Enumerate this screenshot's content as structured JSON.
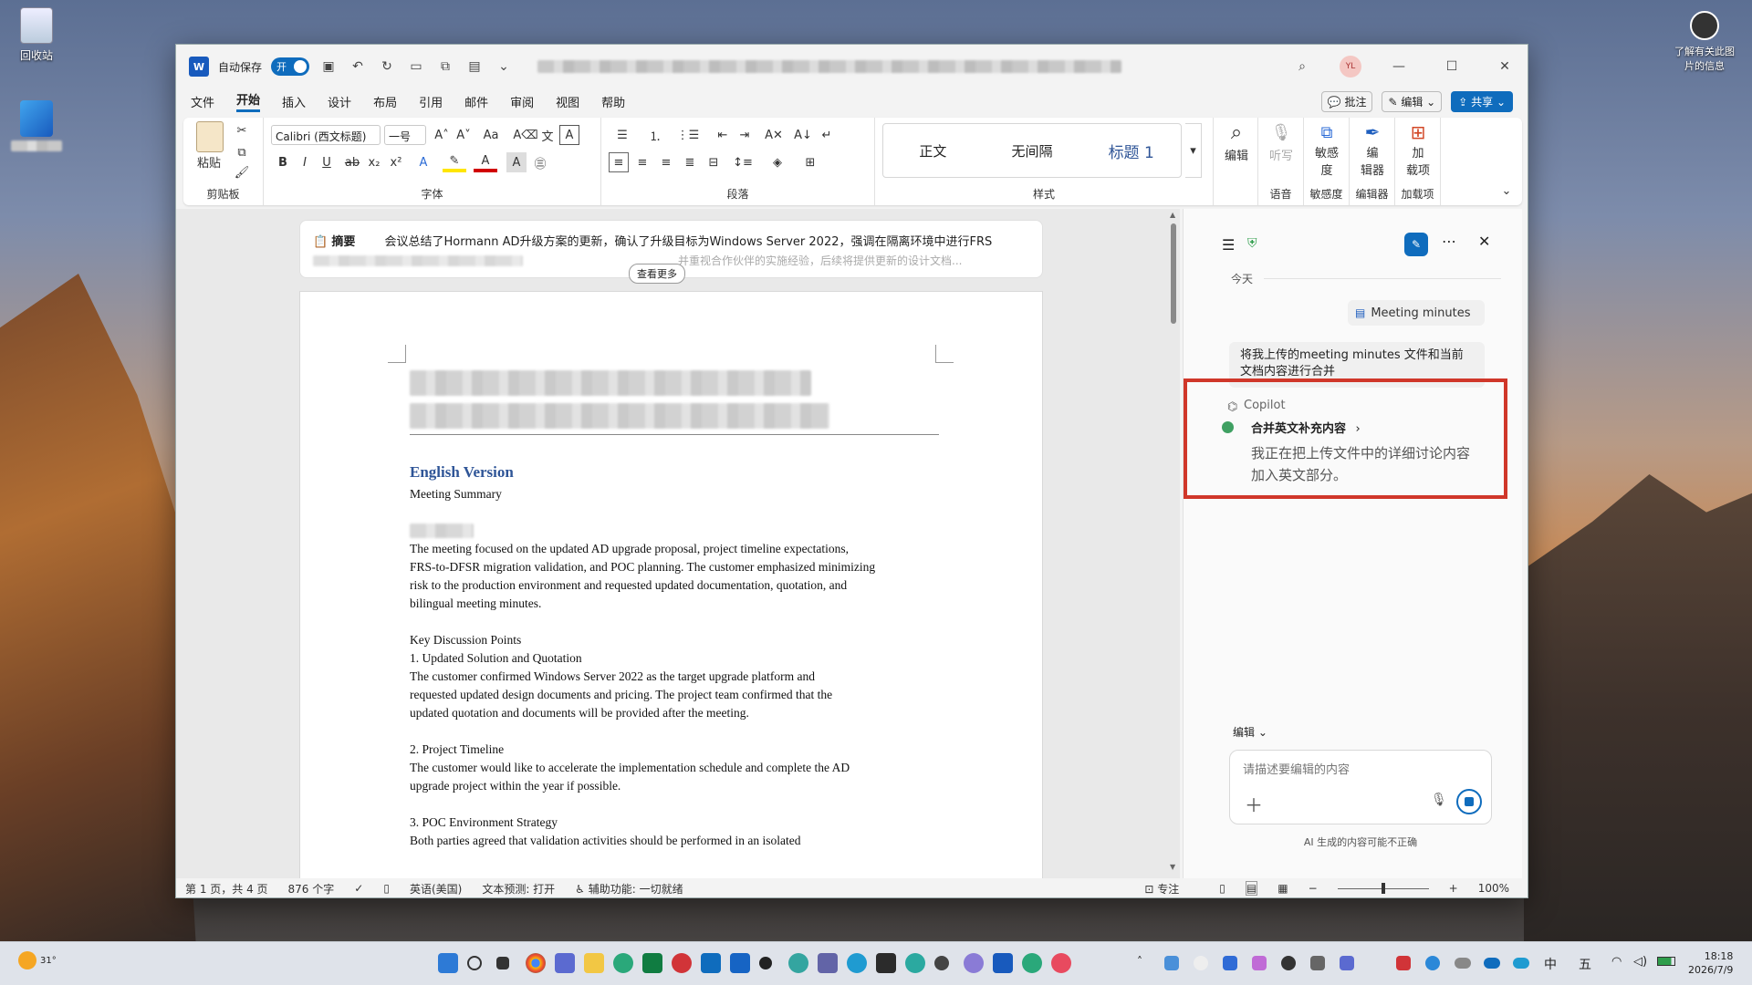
{
  "desktop": {
    "recycle_bin_label": "回收站",
    "info_label": "了解有关此图\n片的信息"
  },
  "titlebar": {
    "autosave_label": "自动保存",
    "autosave_state": "开",
    "user_initials": "YL"
  },
  "menubar": {
    "items": [
      "文件",
      "开始",
      "插入",
      "设计",
      "布局",
      "引用",
      "邮件",
      "审阅",
      "视图",
      "帮助"
    ],
    "active": "开始",
    "comment_label": "批注",
    "edit_label": "编辑",
    "share_label": "共享"
  },
  "ribbon": {
    "clipboard": {
      "paste_label": "粘贴",
      "group_label": "剪贴板"
    },
    "font": {
      "family": "Calibri (西文标题)",
      "size": "一号",
      "group_label": "字体"
    },
    "paragraph": {
      "group_label": "段落"
    },
    "styles": {
      "items": [
        "正文",
        "无间隔",
        "标题 1"
      ],
      "group_label": "样式"
    },
    "editing": {
      "label": "编辑"
    },
    "voice": {
      "dictate_label": "听写",
      "group_label": "语音"
    },
    "sensitivity": {
      "label": "敏感\n度",
      "group_label": "敏感度"
    },
    "editor": {
      "label": "编\n辑器",
      "group_label": "编辑器"
    },
    "addins": {
      "label": "加\n载项",
      "group_label": "加载项"
    }
  },
  "summary": {
    "label": "摘要",
    "text": "会议总结了Hormann AD升级方案的更新，确认了升级目标为Windows Server 2022，强调在隔离环境中进行FRS",
    "text2": "并重视合作伙伴的实施经验，后续将提供更新的设计文档...",
    "see_more": "查看更多"
  },
  "document": {
    "heading": "English Version",
    "lines": [
      {
        "text": "Meeting Summary"
      },
      {
        "text": ""
      },
      {
        "text": ""
      },
      {
        "text": "The meeting focused on the updated AD upgrade proposal, project timeline expectations,"
      },
      {
        "text": "FRS-to-DFSR migration validation, and POC planning. The customer emphasized minimizing"
      },
      {
        "text": "risk to the production environment and requested updated documentation, quotation, and"
      },
      {
        "text": "bilingual meeting minutes."
      },
      {
        "text": ""
      },
      {
        "text": "Key Discussion Points"
      },
      {
        "text": "1. Updated Solution and Quotation"
      },
      {
        "text": "The customer confirmed Windows Server 2022 as the target upgrade platform and"
      },
      {
        "text": "requested updated design documents and pricing. The project team confirmed that the"
      },
      {
        "text": "updated quotation and documents will be provided after the meeting."
      },
      {
        "text": ""
      },
      {
        "text": "2. Project Timeline"
      },
      {
        "text": "The customer would like to accelerate the implementation schedule and complete the AD"
      },
      {
        "text": "upgrade project within the year if possible."
      },
      {
        "text": ""
      },
      {
        "text": "3. POC Environment Strategy"
      },
      {
        "text": "Both parties agreed that validation activities should be performed in an isolated"
      }
    ]
  },
  "copilot": {
    "today_label": "今天",
    "attachment_name": "Meeting minutes",
    "user_message": "将我上传的meeting minutes 文件和当前文档内容进行合并",
    "assistant_name": "Copilot",
    "task_title": "合并英文补充内容",
    "task_detail": "我正在把上传文件中的详细讨论内容加入英文部分。",
    "mode_label": "编辑",
    "input_placeholder": "请描述要编辑的内容",
    "disclaimer": "AI 生成的内容可能不正确"
  },
  "statusbar": {
    "page": "第 1 页，共 4 页",
    "words": "876 个字",
    "language": "英语(美国)",
    "prediction": "文本预测: 打开",
    "accessibility": "辅助功能: 一切就绪",
    "focus": "专注",
    "zoom": "100%"
  },
  "taskbar": {
    "weather": "31°",
    "ime1": "中",
    "ime2": "五",
    "time": "18:18",
    "date": "2026/7/9"
  },
  "colors": {
    "accent": "#0f6cbd",
    "highlight_box": "#d0372a",
    "heading": "#2f5597"
  }
}
